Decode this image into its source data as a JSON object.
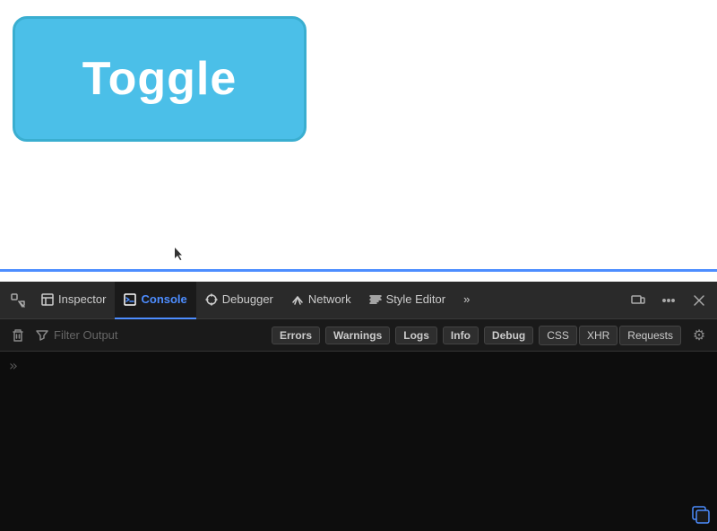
{
  "main": {
    "toggle_button_label": "Toggle",
    "background_color": "#ffffff"
  },
  "devtools": {
    "toolbar": {
      "tabs": [
        {
          "id": "pick",
          "label": "",
          "type": "icon",
          "active": false
        },
        {
          "id": "inspector",
          "label": "Inspector",
          "active": false
        },
        {
          "id": "console",
          "label": "Console",
          "active": true
        },
        {
          "id": "debugger",
          "label": "Debugger",
          "active": false
        },
        {
          "id": "network",
          "label": "Network",
          "active": false
        },
        {
          "id": "style-editor",
          "label": "Style Editor",
          "active": false
        },
        {
          "id": "more",
          "label": "»",
          "active": false
        }
      ],
      "right_buttons": [
        "responsive-icon",
        "more-options",
        "close"
      ]
    },
    "filter_bar": {
      "filter_placeholder": "Filter Output",
      "badges": [
        {
          "label": "Errors",
          "active": false
        },
        {
          "label": "Warnings",
          "active": false
        },
        {
          "label": "Logs",
          "active": false
        },
        {
          "label": "Info",
          "active": false
        },
        {
          "label": "Debug",
          "active": false
        }
      ],
      "right_badges": [
        "CSS",
        "XHR",
        "Requests"
      ],
      "settings_icon": "⚙"
    },
    "console": {
      "prompt_arrows": "»"
    }
  }
}
